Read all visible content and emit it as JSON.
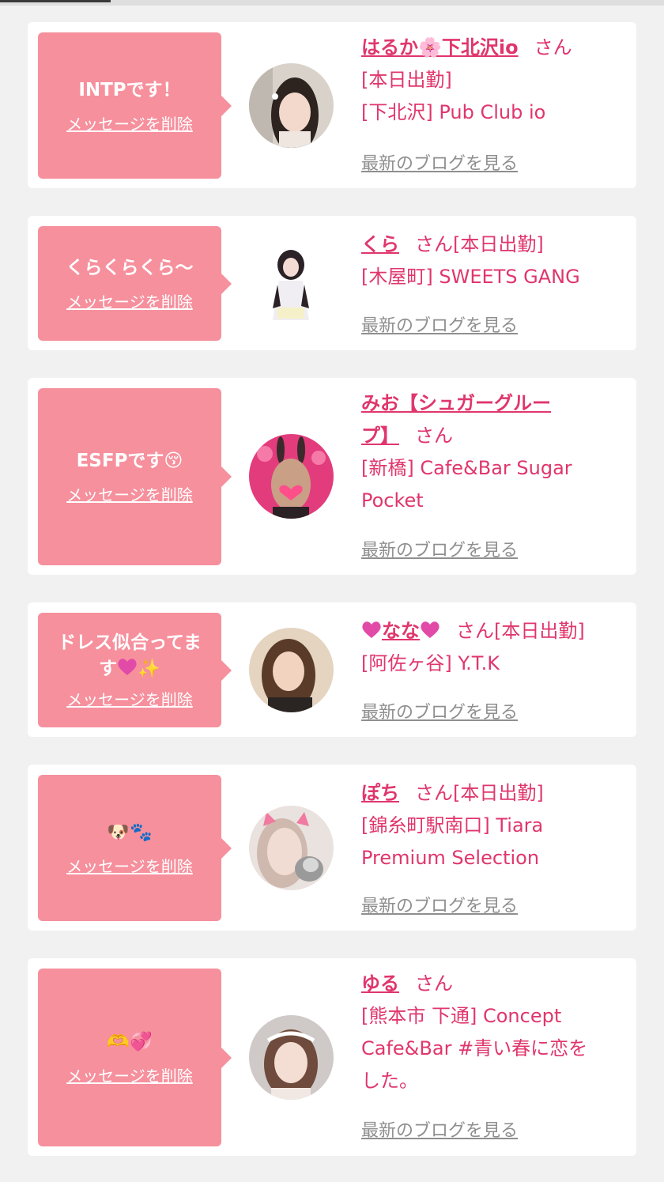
{
  "cards": [
    {
      "message": "INTPです！",
      "delete_label": "メッセージを削除",
      "name": "はるか🌸下北沢io",
      "honorific": "さん",
      "lines": [
        "[本日出勤]",
        "[下北沢] Pub Club io"
      ],
      "blog_label": "最新のブログを見る"
    },
    {
      "message": "くらくらくら〜",
      "delete_label": "メッセージを削除",
      "name": "くら",
      "honorific": "さん",
      "after_honorific": "[本日出勤]",
      "lines": [
        "[木屋町] SWEETS GANG"
      ],
      "blog_label": "最新のブログを見る"
    },
    {
      "message": "ESFPです😚",
      "delete_label": "メッセージを削除",
      "name_line1": "みお【シュガーグルー",
      "name_line2": "プ】",
      "honorific": "さん",
      "lines": [
        "[新橋] Cafe&Bar Sugar",
        "Pocket"
      ],
      "blog_label": "最新のブログを見る"
    },
    {
      "message_line1": "ドレス似合ってま",
      "message_line2": "す",
      "message_emoji": "✨",
      "delete_label": "メッセージを削除",
      "name": "なな",
      "honorific": "さん",
      "after_honorific": "[本日出勤]",
      "lines": [
        "[阿佐ヶ谷] Y.T.K"
      ],
      "blog_label": "最新のブログを見る"
    },
    {
      "message": "🐶🐾",
      "delete_label": "メッセージを削除",
      "name": "ぽち",
      "honorific": "さん",
      "after_honorific": "[本日出勤]",
      "lines": [
        "[錦糸町駅南口] Tiara",
        "Premium Selection"
      ],
      "blog_label": "最新のブログを見る"
    },
    {
      "message": "🫶💞",
      "delete_label": "メッセージを削除",
      "name": "ゆる",
      "honorific": "さん",
      "lines": [
        "[熊本市 下通] Concept",
        "Cafe&Bar #青い春に恋を",
        "した。"
      ],
      "blog_label": "最新のブログを見る"
    }
  ],
  "colors": {
    "accent": "#e0366d",
    "bubble": "#f6909d",
    "link_gray": "#8f8f8f",
    "background": "#f1f1f1"
  },
  "icons": {
    "heart": "heart-icon"
  }
}
